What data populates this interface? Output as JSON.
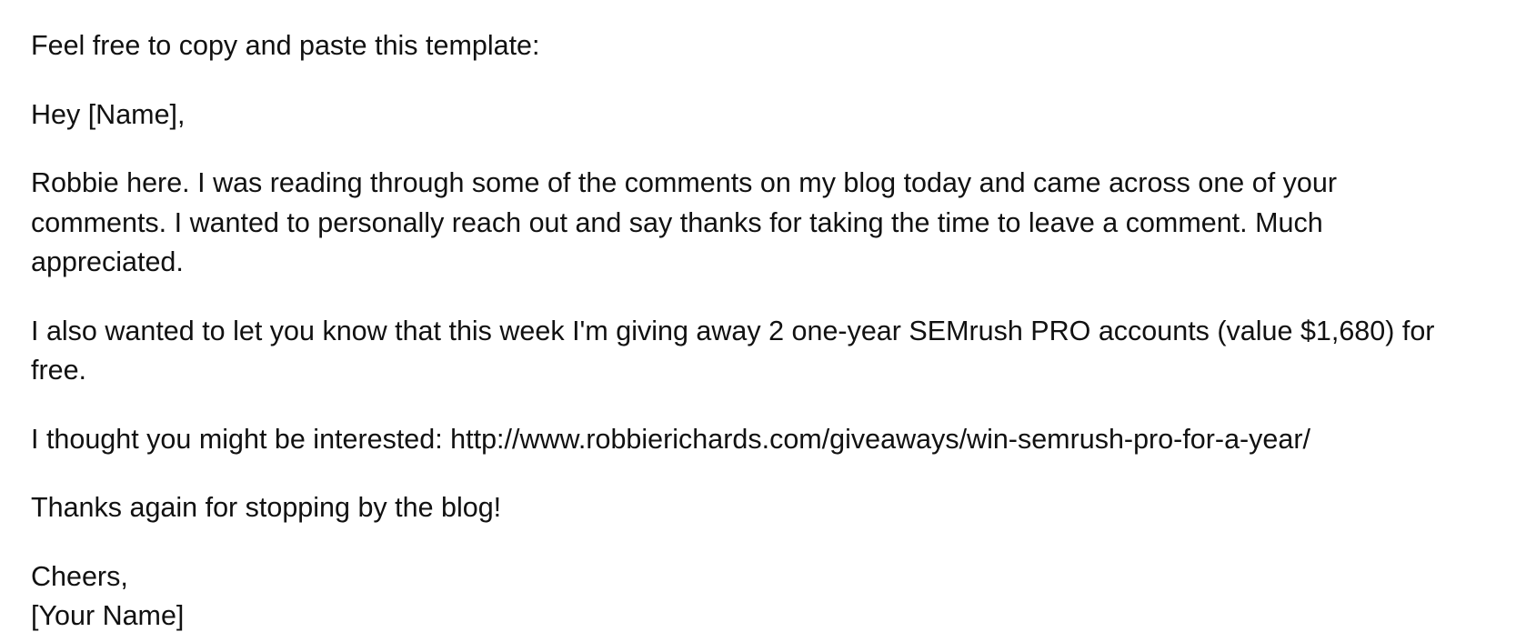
{
  "document": {
    "intro": "Feel free to copy and paste this template:",
    "greeting": "Hey [Name],",
    "paragraph1": {
      "line1": "Robbie here. I was reading through some of the comments on my blog today and came across one of your",
      "line2": "comments. I wanted to personally reach out and say thanks for taking the time to leave a comment. Much",
      "line3": "appreciated."
    },
    "paragraph2": {
      "line1": "I also wanted to let you know that this week I'm giving away 2 one-year SEMrush PRO accounts (value $1,680) for",
      "line2": "free."
    },
    "paragraph3": "I thought you might be interested: http://www.robbierichards.com/giveaways/win-semrush-pro-for-a-year/",
    "paragraph4": "Thanks again for stopping by the blog!",
    "signoff": {
      "closing": "Cheers,",
      "name": "[Your Name]"
    }
  }
}
